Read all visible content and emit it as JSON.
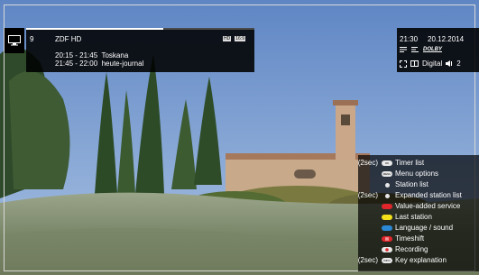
{
  "channel": {
    "number": "9",
    "name": "ZDF HD",
    "progress": 0.6,
    "badges": [
      "HD",
      "16:9"
    ],
    "programs": [
      {
        "time": "20:15 - 21:45",
        "title": "Toskana"
      },
      {
        "time": "21:45 - 22:00",
        "title": "heute-journal"
      }
    ]
  },
  "status": {
    "time": "21:30",
    "date": "20.12.2014",
    "dolby": "DOLBY",
    "audio_mode": "Digital",
    "volume": "2"
  },
  "key_explanation": {
    "items": [
      {
        "prefix": "(2sec)",
        "key": "ok-key",
        "key_text": "OK",
        "label": "Timer list"
      },
      {
        "prefix": "",
        "key": "menu-key",
        "key_text": "MENU",
        "label": "Menu options"
      },
      {
        "prefix": "",
        "key": "dot-key",
        "key_text": "",
        "label": "Station list"
      },
      {
        "prefix": "(2sec)",
        "key": "dot-key",
        "key_text": "",
        "label": "Expanded station list"
      },
      {
        "prefix": "",
        "key": "red-key",
        "color": "#e0262b",
        "label": "Value-added service"
      },
      {
        "prefix": "",
        "key": "yellow-key",
        "color": "#f3df1a",
        "label": "Last station"
      },
      {
        "prefix": "",
        "key": "blue-key",
        "color": "#2a88d4",
        "label": "Language / sound"
      },
      {
        "prefix": "",
        "key": "pause-key",
        "color": "#e0262b",
        "label": "Timeshift"
      },
      {
        "prefix": "",
        "key": "record-key",
        "color": "#e0262b",
        "label": "Recording"
      },
      {
        "prefix": "(2sec)",
        "key": "info-key",
        "key_text": "INFO",
        "label": "Key explanation"
      }
    ]
  }
}
